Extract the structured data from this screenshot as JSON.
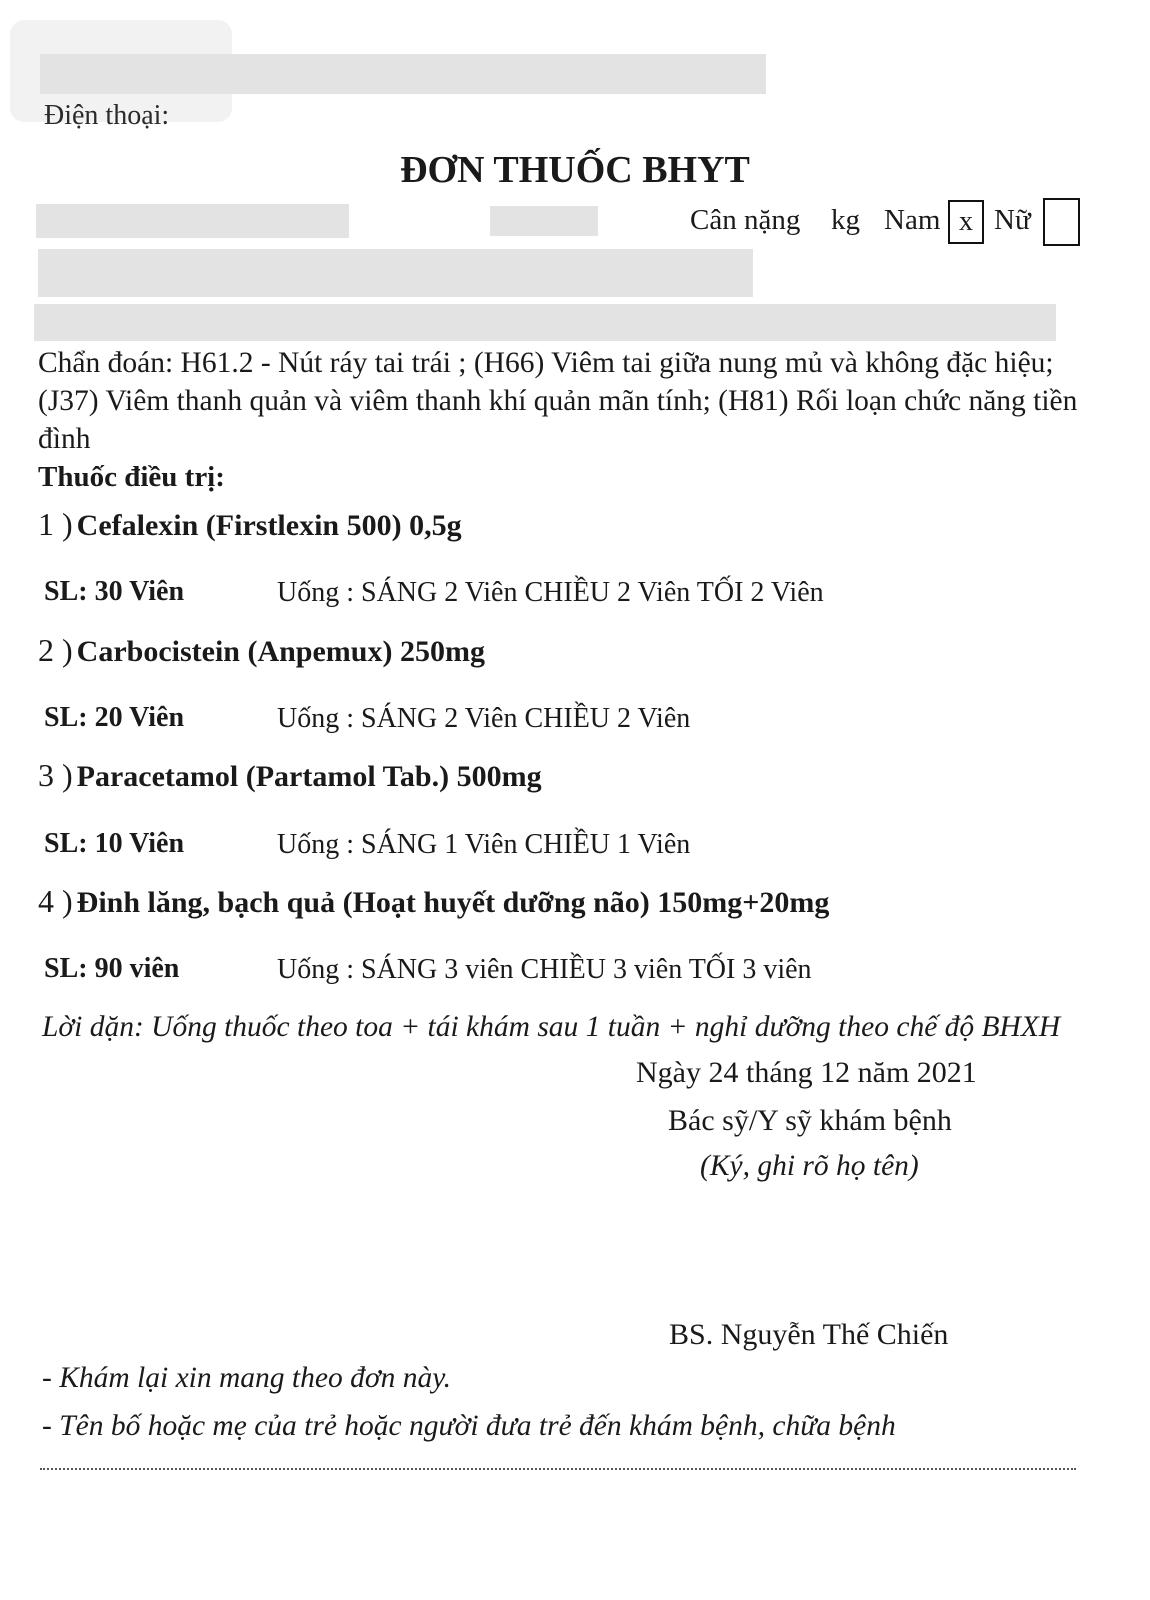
{
  "header": {
    "phone_label": "Điện thoại:"
  },
  "title": "ĐƠN THUỐC BHYT",
  "patient": {
    "weight_label": "Cân nặng",
    "weight_unit": "kg",
    "male_label": "Nam",
    "male_mark": "x",
    "female_label": "Nữ",
    "female_mark": ""
  },
  "diagnosis": "Chẩn đoán: H61.2 - Nút ráy tai trái ; (H66) Viêm tai giữa nung mủ và không đặc hiệu; (J37) Viêm thanh quản và viêm thanh khí quản mãn tính; (H81) Rối loạn chức năng tiền đình",
  "treatment_heading": "Thuốc điều trị:",
  "medications": [
    {
      "number": "1 )",
      "name": "Cefalexin  (Firstlexin 500) 0,5g",
      "quantity": "SL: 30 Viên",
      "dosage": "Uống : SÁNG 2 Viên  CHIỀU 2 Viên TỐI 2 Viên"
    },
    {
      "number": "2 )",
      "name": "Carbocistein  (Anpemux) 250mg",
      "quantity": "SL: 20 Viên",
      "dosage": "Uống : SÁNG 2 Viên  CHIỀU 2 Viên"
    },
    {
      "number": "3 )",
      "name": "Paracetamol  (Partamol Tab.) 500mg",
      "quantity": "SL: 10 Viên",
      "dosage": "Uống : SÁNG 1 Viên  CHIỀU 1 Viên"
    },
    {
      "number": "4 )",
      "name": "Đinh lăng, bạch quả  (Hoạt huyết dưỡng não) 150mg+20mg",
      "quantity": "SL: 90 viên",
      "dosage": "Uống : SÁNG 3 viên  CHIỀU 3 viên TỐI 3 viên"
    }
  ],
  "advice": "Lời dặn: Uống thuốc theo toa + tái khám sau 1 tuần  + nghỉ dưỡng theo chế độ BHXH",
  "signature": {
    "date": "Ngày 24 tháng 12 năm 2021",
    "role": "Bác sỹ/Y sỹ khám bệnh",
    "instruction": "(Ký, ghi rõ họ tên)",
    "doctor_name": "BS. Nguyễn Thế Chiến"
  },
  "footer_notes": [
    "- Khám lại xin mang theo đơn này.",
    "- Tên bố hoặc mẹ của trẻ hoặc người đưa trẻ đến khám bệnh, chữa bệnh"
  ]
}
